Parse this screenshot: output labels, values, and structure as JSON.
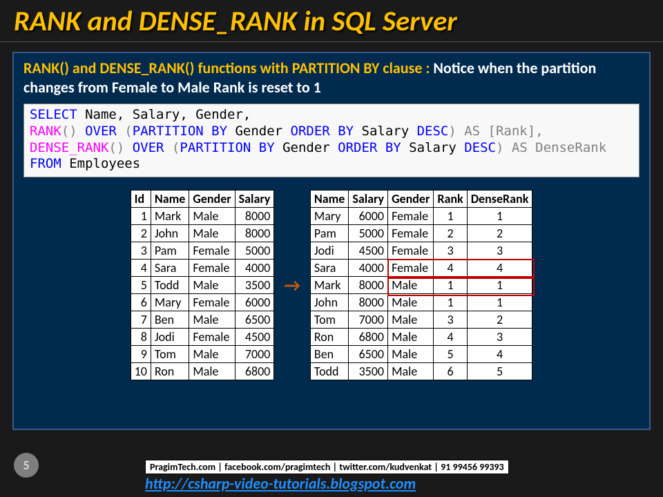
{
  "title": "RANK and DENSE_RANK in SQL Server",
  "subtitle_lead": "RANK() and DENSE_RANK() functions with PARTITION BY clause : ",
  "subtitle_rest": "Notice when the partition changes from Female to Male Rank is reset to 1",
  "code": {
    "select": "SELECT",
    "cols1": " Name, Salary, Gender,",
    "rank": "RANK",
    "over1a": "() ",
    "over_kw": "OVER",
    "over1b": " (",
    "partition_kw": "PARTITION",
    "by_kw1": " BY",
    "pcol": " Gender ",
    "order_kw": "ORDER",
    "by_kw2": " BY",
    "ocol": " Salary ",
    "desc_kw": "DESC",
    "rank_alias": ") AS [Rank],",
    "dense": "DENSE_RANK",
    "over2a": "() ",
    "over2b": " (",
    "dense_alias": ") AS DenseRank",
    "from": "FROM",
    "table": " Employees"
  },
  "left_headers": [
    "Id",
    "Name",
    "Gender",
    "Salary"
  ],
  "left_rows": [
    [
      "1",
      "Mark",
      "Male",
      "8000"
    ],
    [
      "2",
      "John",
      "Male",
      "8000"
    ],
    [
      "3",
      "Pam",
      "Female",
      "5000"
    ],
    [
      "4",
      "Sara",
      "Female",
      "4000"
    ],
    [
      "5",
      "Todd",
      "Male",
      "3500"
    ],
    [
      "6",
      "Mary",
      "Female",
      "6000"
    ],
    [
      "7",
      "Ben",
      "Male",
      "6500"
    ],
    [
      "8",
      "Jodi",
      "Female",
      "4500"
    ],
    [
      "9",
      "Tom",
      "Male",
      "7000"
    ],
    [
      "10",
      "Ron",
      "Male",
      "6800"
    ]
  ],
  "right_headers": [
    "Name",
    "Salary",
    "Gender",
    "Rank",
    "DenseRank"
  ],
  "right_rows": [
    [
      "Mary",
      "6000",
      "Female",
      "1",
      "1"
    ],
    [
      "Pam",
      "5000",
      "Female",
      "2",
      "2"
    ],
    [
      "Jodi",
      "4500",
      "Female",
      "3",
      "3"
    ],
    [
      "Sara",
      "4000",
      "Female",
      "4",
      "4"
    ],
    [
      "Mark",
      "8000",
      "Male",
      "1",
      "1"
    ],
    [
      "John",
      "8000",
      "Male",
      "1",
      "1"
    ],
    [
      "Tom",
      "7000",
      "Male",
      "3",
      "2"
    ],
    [
      "Ron",
      "6800",
      "Male",
      "4",
      "3"
    ],
    [
      "Ben",
      "6500",
      "Male",
      "5",
      "4"
    ],
    [
      "Todd",
      "3500",
      "Male",
      "6",
      "5"
    ]
  ],
  "arrow": "→",
  "page_num": "5",
  "footer_box": "PragimTech.com | facebook.com/pragimtech | twitter.com/kudvenkat | 91 99456 99393",
  "footer_link": "http://csharp-video-tutorials.blogspot.com"
}
